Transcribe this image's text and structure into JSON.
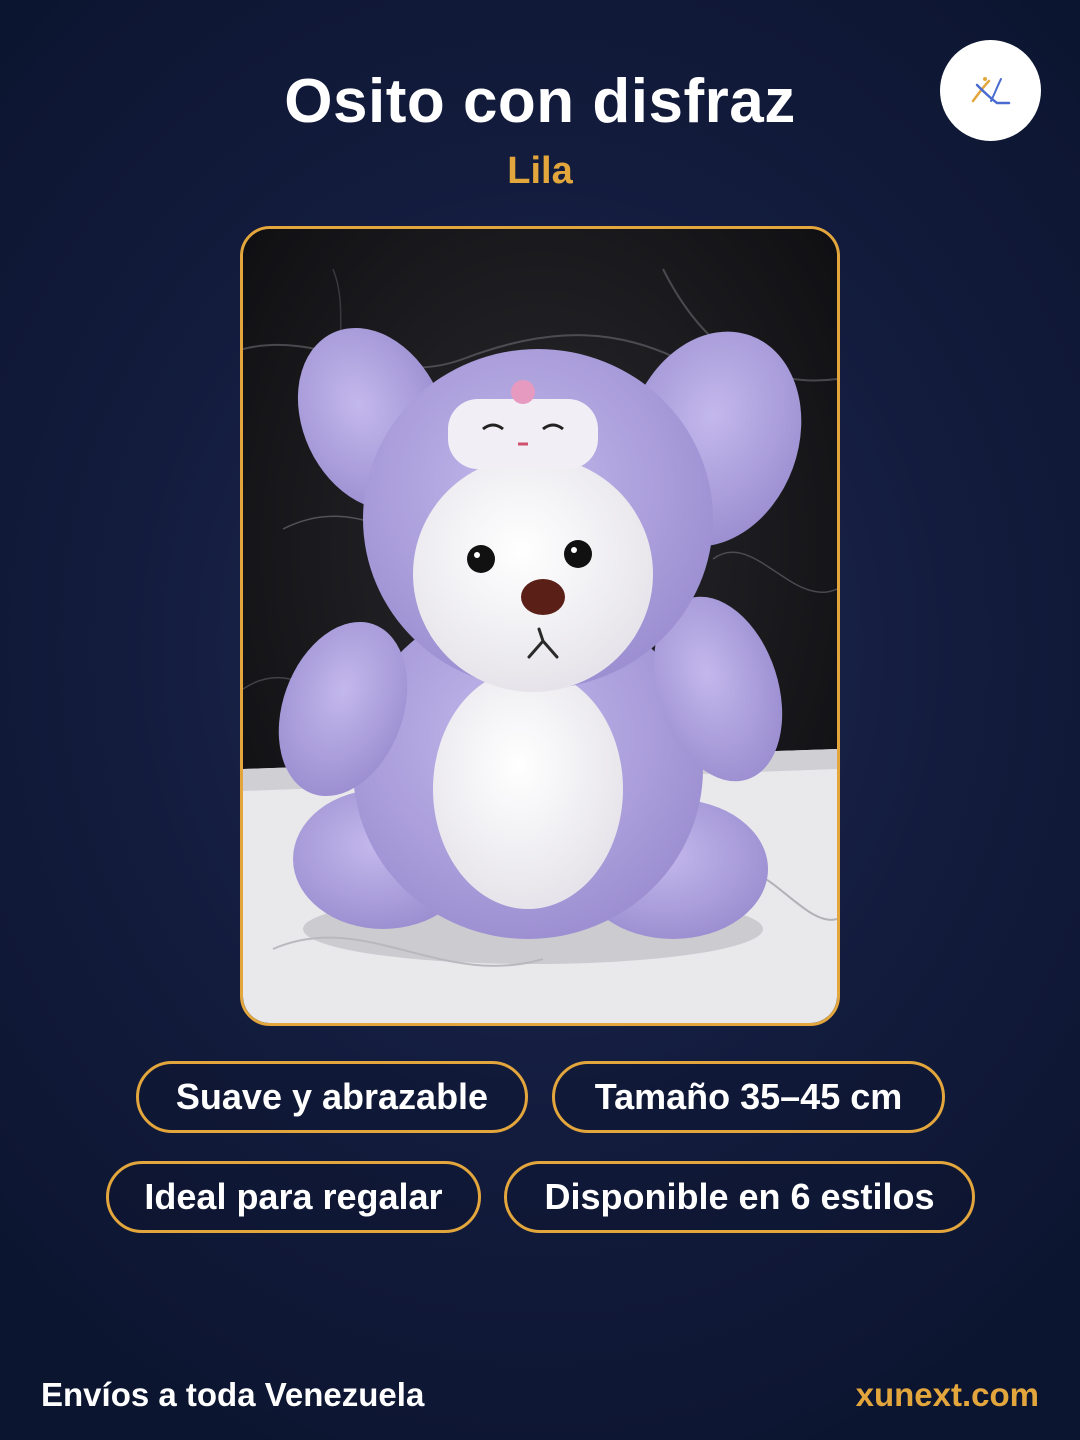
{
  "header": {
    "title": "Osito con disfraz",
    "subtitle": "Lila"
  },
  "logo": {
    "icon": "brand-logo-icon"
  },
  "product_image": {
    "icon": "plush-bear-photo"
  },
  "features": [
    "Suave y abrazable",
    "Tamaño 35–45 cm",
    "Ideal para regalar",
    "Disponible en 6 estilos"
  ],
  "footer": {
    "shipping": "Envíos a toda Venezuela",
    "website": "xunext.com"
  },
  "colors": {
    "background": "#131c3d",
    "accent": "#e3a63c",
    "text": "#ffffff"
  }
}
